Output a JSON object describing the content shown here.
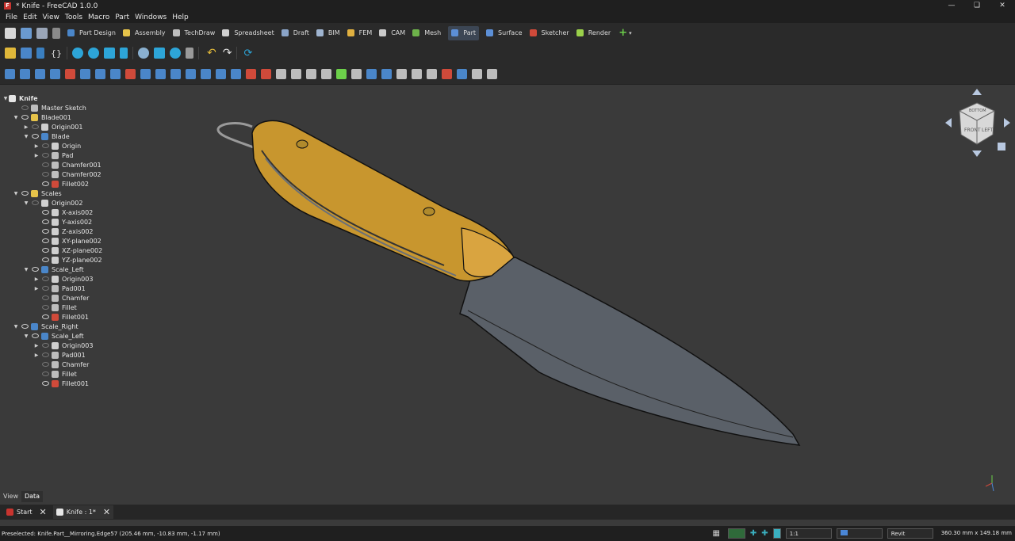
{
  "window": {
    "title": "* Knife - FreeCAD 1.0.0",
    "app_icon": "freecad-icon"
  },
  "menu": [
    "File",
    "Edit",
    "View",
    "Tools",
    "Macro",
    "Part",
    "Windows",
    "Help"
  ],
  "workbenches": [
    {
      "label": "Part Design",
      "color": "#4a86c9"
    },
    {
      "label": "Assembly",
      "color": "#e6c34a"
    },
    {
      "label": "TechDraw",
      "color": "#bdbdbd"
    },
    {
      "label": "Spreadsheet",
      "color": "#d0d0d0"
    },
    {
      "label": "Draft",
      "color": "#8aa4c8"
    },
    {
      "label": "BIM",
      "color": "#9fb4d0"
    },
    {
      "label": "FEM",
      "color": "#e0b040"
    },
    {
      "label": "CAM",
      "color": "#c9c9c9"
    },
    {
      "label": "Mesh",
      "color": "#6db24a"
    },
    {
      "label": "Part",
      "color": "#5c8fd6"
    },
    {
      "label": "Surface",
      "color": "#5c8fd6"
    },
    {
      "label": "Sketcher",
      "color": "#d04a3a"
    },
    {
      "label": "Render",
      "color": "#9ad04a"
    }
  ],
  "tree": [
    {
      "label": "Knife",
      "icon": "document-icon",
      "level": 0,
      "expanded": true,
      "eye": false
    },
    {
      "label": "Master Sketch",
      "icon": "sketch-icon",
      "level": 1,
      "expanded": null,
      "eye": false
    },
    {
      "label": "Blade001",
      "icon": "part-icon",
      "level": 1,
      "expanded": true,
      "eye": true
    },
    {
      "label": "Origin001",
      "icon": "origin-icon",
      "level": 2,
      "expanded": false,
      "eye": false
    },
    {
      "label": "Blade",
      "icon": "body-icon",
      "level": 2,
      "expanded": true,
      "eye": true
    },
    {
      "label": "Origin",
      "icon": "origin-icon",
      "level": 3,
      "expanded": false,
      "eye": false
    },
    {
      "label": "Pad",
      "icon": "pad-icon",
      "level": 3,
      "expanded": false,
      "eye": false
    },
    {
      "label": "Chamfer001",
      "icon": "chamfer-icon",
      "level": 3,
      "expanded": null,
      "eye": false
    },
    {
      "label": "Chamfer002",
      "icon": "chamfer-icon",
      "level": 3,
      "expanded": null,
      "eye": false
    },
    {
      "label": "Fillet002",
      "icon": "fillet-icon",
      "level": 3,
      "expanded": null,
      "eye": true
    },
    {
      "label": "Scales",
      "icon": "part-icon",
      "level": 1,
      "expanded": true,
      "eye": true
    },
    {
      "label": "Origin002",
      "icon": "origin-icon",
      "level": 2,
      "expanded": true,
      "eye": false
    },
    {
      "label": "X-axis002",
      "icon": "axis-icon",
      "level": 3,
      "expanded": null,
      "eye": true
    },
    {
      "label": "Y-axis002",
      "icon": "axis-icon",
      "level": 3,
      "expanded": null,
      "eye": true
    },
    {
      "label": "Z-axis002",
      "icon": "axis-icon",
      "level": 3,
      "expanded": null,
      "eye": true
    },
    {
      "label": "XY-plane002",
      "icon": "plane-icon",
      "level": 3,
      "expanded": null,
      "eye": true
    },
    {
      "label": "XZ-plane002",
      "icon": "plane-icon",
      "level": 3,
      "expanded": null,
      "eye": true
    },
    {
      "label": "YZ-plane002",
      "icon": "plane-icon",
      "level": 3,
      "expanded": null,
      "eye": true
    },
    {
      "label": "Scale_Left",
      "icon": "body-icon",
      "level": 2,
      "expanded": true,
      "eye": true
    },
    {
      "label": "Origin003",
      "icon": "origin-icon",
      "level": 3,
      "expanded": false,
      "eye": false
    },
    {
      "label": "Pad001",
      "icon": "pad-icon",
      "level": 3,
      "expanded": false,
      "eye": false
    },
    {
      "label": "Chamfer",
      "icon": "chamfer-icon",
      "level": 3,
      "expanded": null,
      "eye": false
    },
    {
      "label": "Fillet",
      "icon": "chamfer-icon",
      "level": 3,
      "expanded": null,
      "eye": false
    },
    {
      "label": "Fillet001",
      "icon": "fillet-icon",
      "level": 3,
      "expanded": null,
      "eye": true
    },
    {
      "label": "Scale_Right",
      "icon": "mirror-icon",
      "level": 1,
      "expanded": true,
      "eye": true
    },
    {
      "label": "Scale_Left",
      "icon": "body-icon",
      "level": 2,
      "expanded": true,
      "eye": true
    },
    {
      "label": "Origin003",
      "icon": "origin-icon",
      "level": 3,
      "expanded": false,
      "eye": false
    },
    {
      "label": "Pad001",
      "icon": "pad-icon",
      "level": 3,
      "expanded": false,
      "eye": false
    },
    {
      "label": "Chamfer",
      "icon": "chamfer-icon",
      "level": 3,
      "expanded": null,
      "eye": false
    },
    {
      "label": "Fillet",
      "icon": "chamfer-icon",
      "level": 3,
      "expanded": null,
      "eye": false
    },
    {
      "label": "Fillet001",
      "icon": "fillet-icon",
      "level": 3,
      "expanded": null,
      "eye": true
    }
  ],
  "panel_tabs": [
    "View",
    "Data"
  ],
  "doc_tabs": [
    {
      "label": "Start"
    },
    {
      "label": "Knife : 1*"
    }
  ],
  "status": {
    "text": "Preselected: Knife.Part__Mirroring.Edge57 (205.46 mm, -10.83 mm, -1.17 mm)",
    "zoom": "1:1",
    "nav_style": "Revit",
    "dimensions": "360.30 mm x 149.18 mm"
  },
  "navcube": {
    "faces": [
      "FRONT",
      "LEFT",
      "BOTTOM"
    ]
  },
  "colors": {
    "handle": "#c8962e",
    "blade": "#5a6068",
    "background": "#3a3a3a"
  }
}
